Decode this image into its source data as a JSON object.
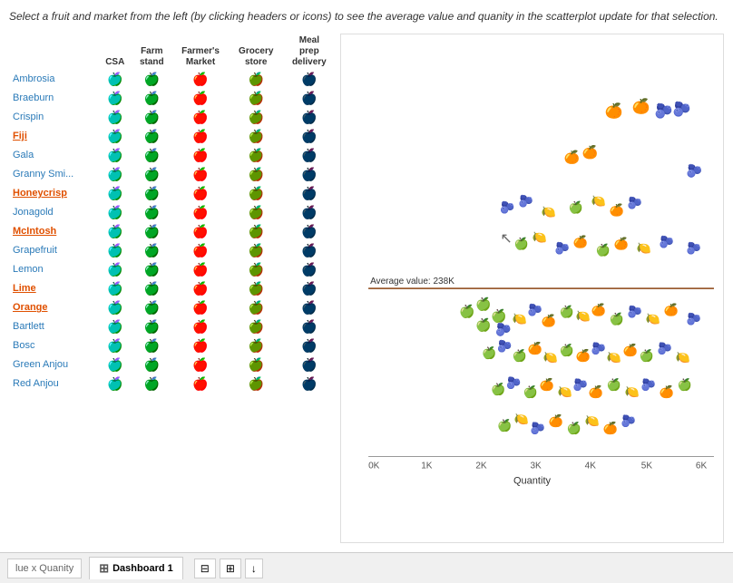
{
  "instruction": "Select a fruit and market from the left (by clicking  headers or icons) to see the average value and quanity in the scatterplot update for that selection.",
  "table": {
    "columns": [
      "CSA",
      "Farm stand",
      "Farmer's Market",
      "Grocery store",
      "Meal prep delivery"
    ],
    "rows": [
      {
        "name": "Ambrosia",
        "style": "normal"
      },
      {
        "name": "Braeburn",
        "style": "normal"
      },
      {
        "name": "Crispin",
        "style": "normal"
      },
      {
        "name": "Fiji",
        "style": "selected"
      },
      {
        "name": "Gala",
        "style": "normal"
      },
      {
        "name": "Granny Smi...",
        "style": "normal"
      },
      {
        "name": "Honeycrisp",
        "style": "selected"
      },
      {
        "name": "Jonagold",
        "style": "normal"
      },
      {
        "name": "McIntosh",
        "style": "selected"
      },
      {
        "name": "Grapefruit",
        "style": "normal"
      },
      {
        "name": "Lemon",
        "style": "normal"
      },
      {
        "name": "Lime",
        "style": "selected"
      },
      {
        "name": "Orange",
        "style": "selected"
      },
      {
        "name": "Bartlett",
        "style": "normal"
      },
      {
        "name": "Bosc",
        "style": "normal"
      },
      {
        "name": "Green Anjou",
        "style": "normal"
      },
      {
        "name": "Red Anjou",
        "style": "normal"
      }
    ]
  },
  "scatterplot": {
    "avg_value_label": "Average value: 238K",
    "x_axis_label": "Quantity",
    "x_ticks": [
      "0K",
      "1K",
      "2K",
      "3K",
      "4K",
      "5K",
      "6K"
    ],
    "y_axis_label": ""
  },
  "bottombar": {
    "sheet_label": "lue x Quanity",
    "tab_label": "Dashboard 1",
    "tab_icon": "⊞",
    "btn1": "⊟",
    "btn2": "⊞",
    "btn3": "↓"
  }
}
